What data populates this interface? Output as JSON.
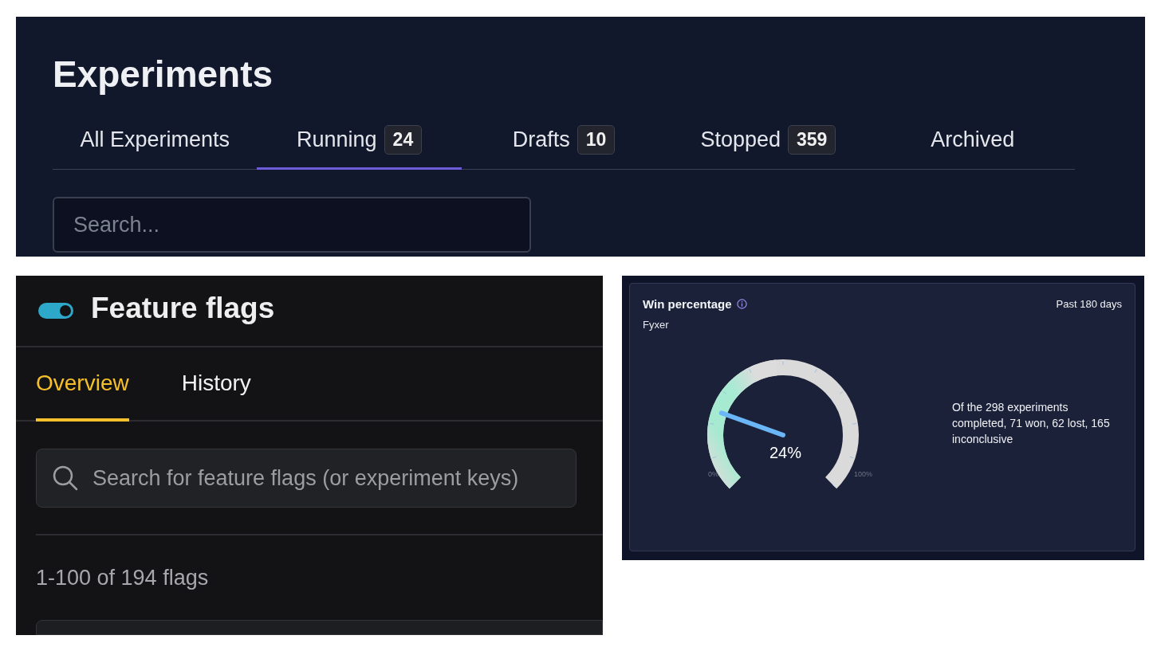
{
  "experiments": {
    "title": "Experiments",
    "tabs": [
      {
        "label": "All Experiments",
        "selected": false
      },
      {
        "label": "Running",
        "count": "24",
        "selected": true
      },
      {
        "label": "Drafts",
        "count": "10",
        "selected": false
      },
      {
        "label": "Stopped",
        "count": "359",
        "selected": false
      },
      {
        "label": "Archived",
        "selected": false
      }
    ],
    "search": {
      "placeholder": "Search..."
    }
  },
  "feature_flags": {
    "title": "Feature flags",
    "toggle_on": true,
    "tabs": [
      {
        "label": "Overview",
        "selected": true
      },
      {
        "label": "History",
        "selected": false
      }
    ],
    "search": {
      "placeholder": "Search for feature flags (or experiment keys)"
    },
    "count": "1-100 of 194 flags"
  },
  "win_card": {
    "title": "Win percentage",
    "period": "Past 180 days",
    "subtitle": "Fyxer",
    "gauge": {
      "level": 0.24,
      "value": "24%",
      "min_label": "0%",
      "max_label": "100%"
    },
    "summary": "Of the 298 experiments completed, 71 won, 62 lost, 165 inconclusive"
  }
}
